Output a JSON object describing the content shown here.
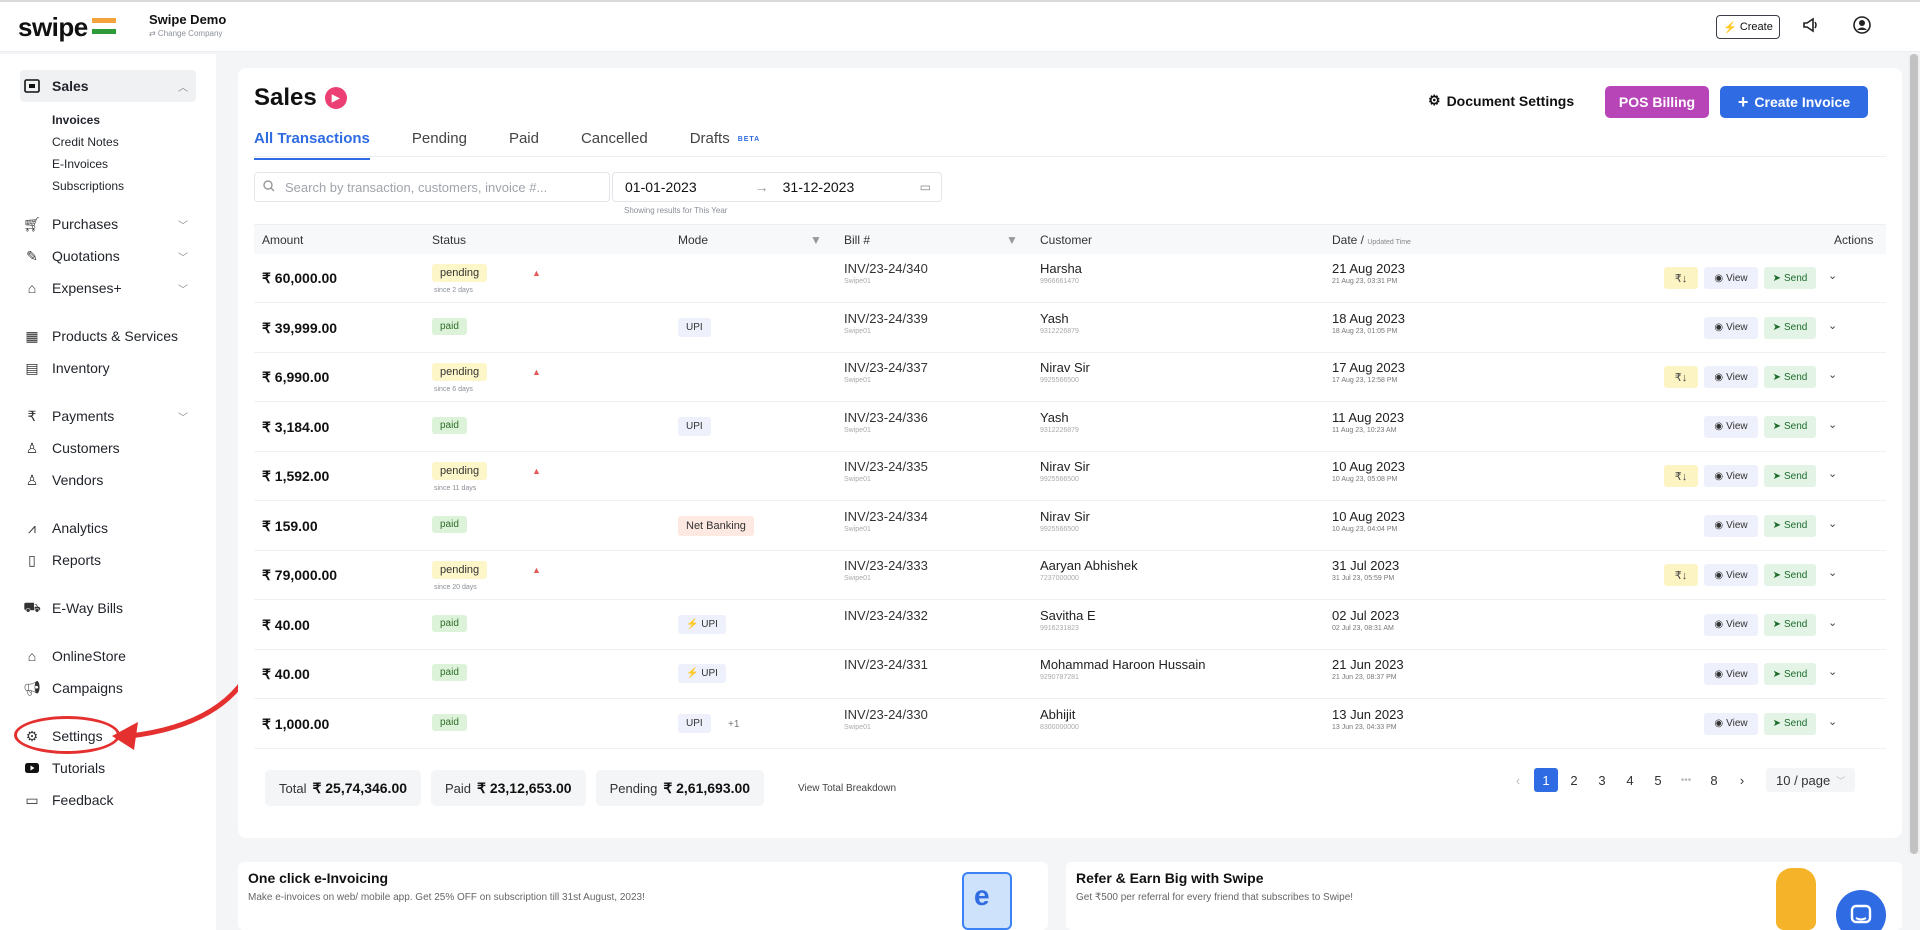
{
  "app": {
    "logo_text": "swipe",
    "company_name": "Swipe Demo",
    "company_sub": "⇄ Change Company",
    "create_label": "Create"
  },
  "sidebar": {
    "sales_label": "Sales",
    "sales_sub": [
      "Invoices",
      "Credit Notes",
      "E-Invoices",
      "Subscriptions"
    ],
    "items": [
      {
        "label": "Purchases",
        "icon": "cart-icon"
      },
      {
        "label": "Quotations",
        "icon": "pen-icon"
      },
      {
        "label": "Expenses+",
        "icon": "tag-icon"
      },
      {
        "label": "Products & Services",
        "icon": "products-icon"
      },
      {
        "label": "Inventory",
        "icon": "inventory-icon"
      },
      {
        "label": "Payments",
        "icon": "rupee-icon"
      },
      {
        "label": "Customers",
        "icon": "user-icon"
      },
      {
        "label": "Vendors",
        "icon": "users-icon"
      },
      {
        "label": "Analytics",
        "icon": "analytics-icon"
      },
      {
        "label": "Reports",
        "icon": "report-icon"
      },
      {
        "label": "E-Way Bills",
        "icon": "truck-icon"
      },
      {
        "label": "OnlineStore",
        "icon": "store-icon"
      },
      {
        "label": "Campaigns",
        "icon": "megaphone-icon"
      },
      {
        "label": "Settings",
        "icon": "gear-icon"
      },
      {
        "label": "Tutorials",
        "icon": "youtube-icon"
      },
      {
        "label": "Feedback",
        "icon": "chat-icon"
      }
    ]
  },
  "page": {
    "title": "Sales",
    "doc_settings": "Document Settings",
    "pos_billing": "POS Billing",
    "create_invoice": "Create Invoice",
    "tabs": [
      "All Transactions",
      "Pending",
      "Paid",
      "Cancelled",
      "Drafts"
    ],
    "beta": "BETA",
    "search_placeholder": "Search by transaction, customers, invoice #...",
    "date_from": "01-01-2023",
    "date_to": "31-12-2023",
    "date_hint": "Showing results for This Year"
  },
  "table": {
    "headers": {
      "amount": "Amount",
      "status": "Status",
      "mode": "Mode",
      "bill": "Bill #",
      "customer": "Customer",
      "date": "Date / ",
      "date_small": "Updated Time",
      "actions": "Actions"
    },
    "view_label": "View",
    "send_label": "Send",
    "inr_label": "₹↓",
    "rows": [
      {
        "amount": "₹ 60,000.00",
        "status": "pending",
        "due": "since 2 days",
        "mode": "",
        "bill": "INV/23-24/340",
        "bill_sub": "Swipe01",
        "customer": "Harsha",
        "cust_sub": "9966661470",
        "date": "21 Aug 2023",
        "date_sub": "21 Aug 23, 03:31 PM",
        "inr": true
      },
      {
        "amount": "₹ 39,999.00",
        "status": "paid",
        "due": "",
        "mode": "UPI",
        "bill": "INV/23-24/339",
        "bill_sub": "Swipe01",
        "customer": "Yash",
        "cust_sub": "9312226879",
        "date": "18 Aug 2023",
        "date_sub": "18 Aug 23, 01:05 PM",
        "inr": false
      },
      {
        "amount": "₹ 6,990.00",
        "status": "pending",
        "due": "since 6 days",
        "mode": "",
        "bill": "INV/23-24/337",
        "bill_sub": "Swipe01",
        "customer": "Nirav Sir",
        "cust_sub": "9925566500",
        "date": "17 Aug 2023",
        "date_sub": "17 Aug 23, 12:58 PM",
        "inr": true
      },
      {
        "amount": "₹ 3,184.00",
        "status": "paid",
        "due": "",
        "mode": "UPI",
        "bill": "INV/23-24/336",
        "bill_sub": "Swipe01",
        "customer": "Yash",
        "cust_sub": "9312226879",
        "date": "11 Aug 2023",
        "date_sub": "11 Aug 23, 10:23 AM",
        "inr": false
      },
      {
        "amount": "₹ 1,592.00",
        "status": "pending",
        "due": "since 11 days",
        "mode": "",
        "bill": "INV/23-24/335",
        "bill_sub": "Swipe01",
        "customer": "Nirav Sir",
        "cust_sub": "9925566500",
        "date": "10 Aug 2023",
        "date_sub": "10 Aug 23, 05:08 PM",
        "inr": true
      },
      {
        "amount": "₹ 159.00",
        "status": "paid",
        "due": "",
        "mode": "Net Banking",
        "bill": "INV/23-24/334",
        "bill_sub": "Swipe01",
        "customer": "Nirav Sir",
        "cust_sub": "9925566500",
        "date": "10 Aug 2023",
        "date_sub": "10 Aug 23, 04:04 PM",
        "inr": false
      },
      {
        "amount": "₹ 79,000.00",
        "status": "pending",
        "due": "since 20 days",
        "mode": "",
        "bill": "INV/23-24/333",
        "bill_sub": "Swipe01",
        "customer": "Aaryan Abhishek",
        "cust_sub": "7237000000",
        "date": "31 Jul 2023",
        "date_sub": "31 Jul 23, 05:59 PM",
        "inr": true
      },
      {
        "amount": "₹ 40.00",
        "status": "paid",
        "due": "",
        "mode": "⚡ UPI",
        "bill": "INV/23-24/332",
        "bill_sub": "",
        "customer": "Savitha E",
        "cust_sub": "9916231823",
        "date": "02 Jul 2023",
        "date_sub": "02 Jul 23, 08:31 AM",
        "inr": false
      },
      {
        "amount": "₹ 40.00",
        "status": "paid",
        "due": "",
        "mode": "⚡ UPI",
        "bill": "INV/23-24/331",
        "bill_sub": "",
        "customer": "Mohammad Haroon Hussain",
        "cust_sub": "9290787281",
        "date": "21 Jun 2023",
        "date_sub": "21 Jun 23, 08:37 PM",
        "inr": false
      },
      {
        "amount": "₹ 1,000.00",
        "status": "paid",
        "due": "",
        "mode": "UPI",
        "mode_extra": "+1",
        "bill": "INV/23-24/330",
        "bill_sub": "Swipe01",
        "customer": "Abhijit",
        "cust_sub": "8300000000",
        "date": "13 Jun 2023",
        "date_sub": "13 Jun 23, 04:33 PM",
        "inr": false
      }
    ]
  },
  "totals": {
    "total_label": "Total",
    "total_value": "₹ 25,74,346.00",
    "paid_label": "Paid",
    "paid_value": "₹ 23,12,653.00",
    "pending_label": "Pending",
    "pending_value": "₹ 2,61,693.00",
    "breakdown": "View Total Breakdown"
  },
  "pagination": {
    "pages": [
      "1",
      "2",
      "3",
      "4",
      "5",
      "•••",
      "8"
    ],
    "per_page": "10 / page"
  },
  "promos": [
    {
      "title": "One click e-Invoicing",
      "sub": "Make e-invoices on web/ mobile app. Get 25% OFF on subscription till 31st August, 2023!"
    },
    {
      "title": "Refer & Earn Big with Swipe",
      "sub": "Get ₹500 per referral for every friend that subscribes to Swipe!"
    }
  ],
  "colors": {
    "accent": "#2f6be2",
    "pos": "#b845b8",
    "highlight": "#e53030"
  }
}
